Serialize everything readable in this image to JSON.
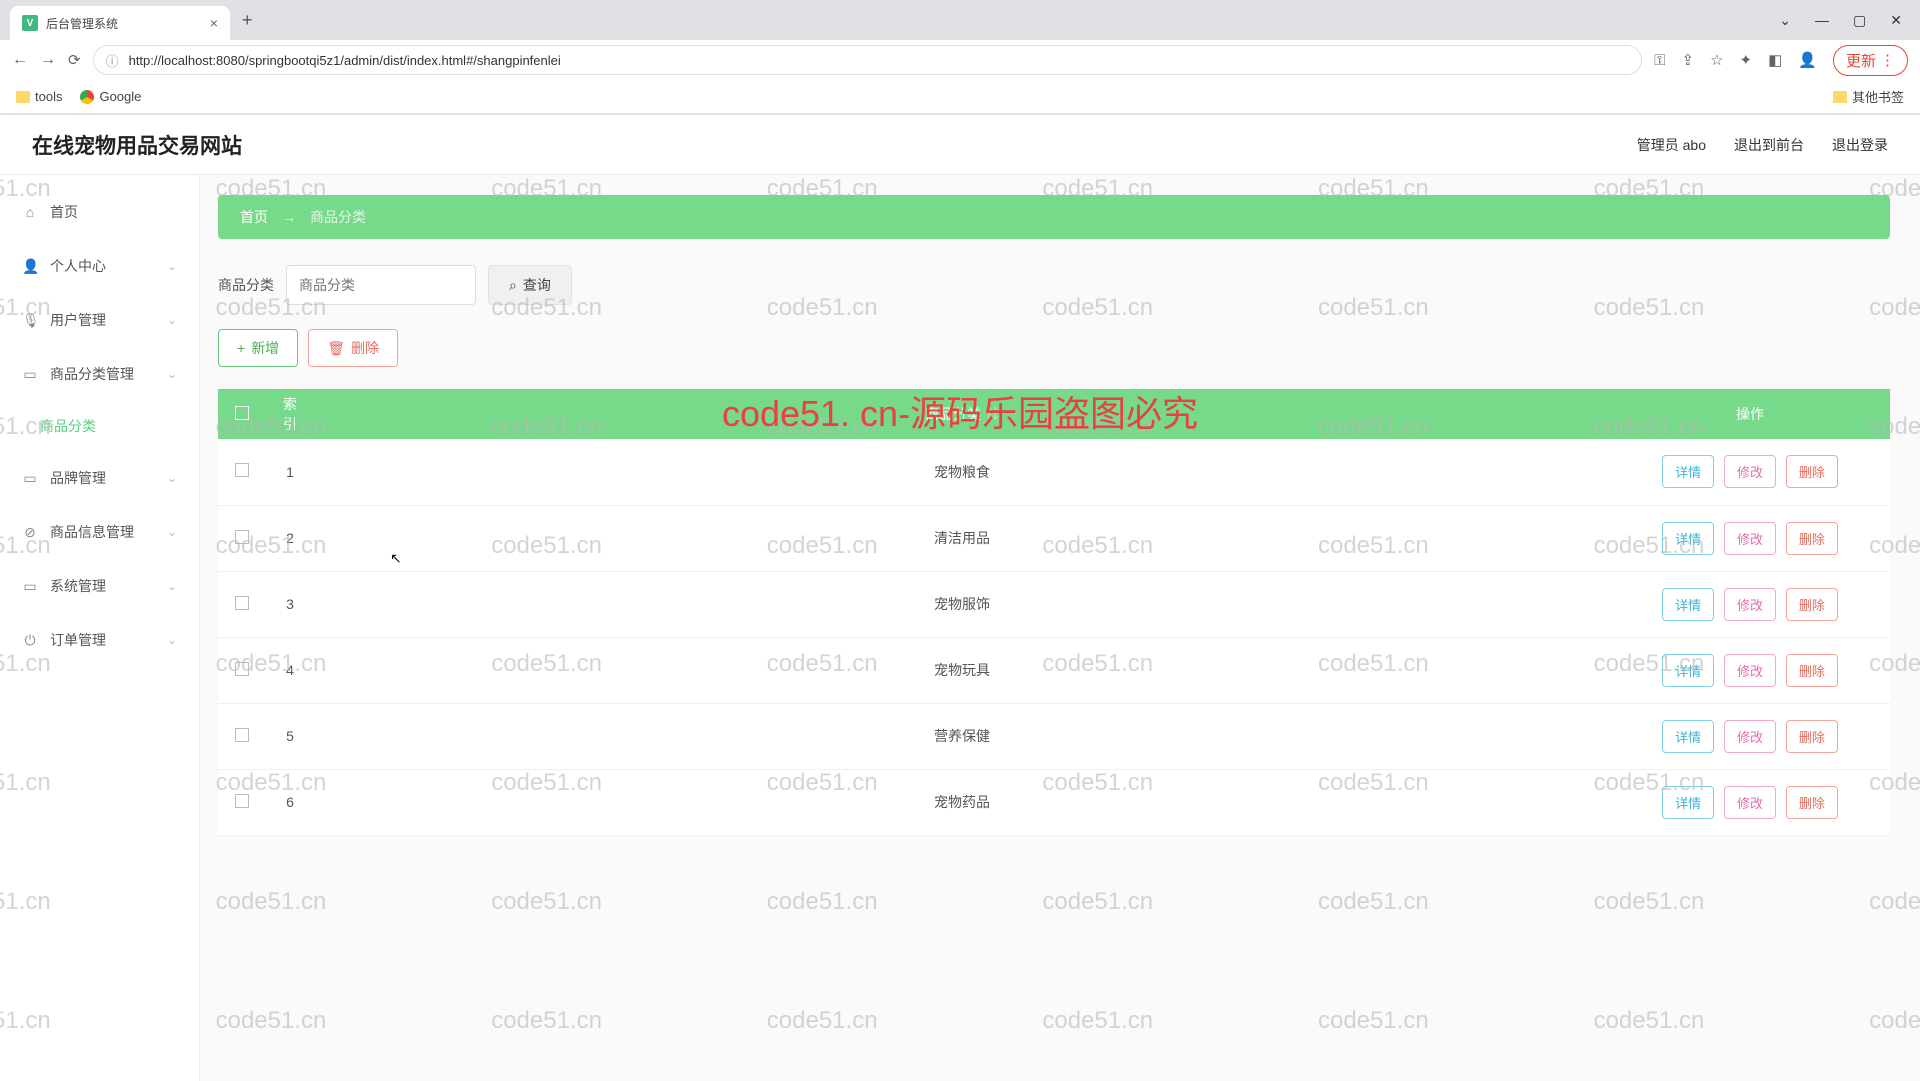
{
  "browser": {
    "tab_title": "后台管理系统",
    "url": "http://localhost:8080/springbootqi5z1/admin/dist/index.html#/shangpinfenlei",
    "bookmarks": {
      "tools": "tools",
      "google": "Google",
      "other": "其他书签"
    },
    "update": "更新"
  },
  "header": {
    "title": "在线宠物用品交易网站",
    "admin": "管理员 abo",
    "logout_front": "退出到前台",
    "logout": "退出登录"
  },
  "sidebar": {
    "items": [
      {
        "icon": "⌂",
        "label": "首页",
        "expandable": false
      },
      {
        "icon": "👤",
        "label": "个人中心",
        "expandable": true
      },
      {
        "icon": "🎙",
        "label": "用户管理",
        "expandable": true
      },
      {
        "icon": "▭",
        "label": "商品分类管理",
        "expandable": true,
        "sub": "商品分类"
      },
      {
        "icon": "▭",
        "label": "品牌管理",
        "expandable": true
      },
      {
        "icon": "⊘",
        "label": "商品信息管理",
        "expandable": true
      },
      {
        "icon": "▭",
        "label": "系统管理",
        "expandable": true
      },
      {
        "icon": "⏻",
        "label": "订单管理",
        "expandable": true
      }
    ]
  },
  "breadcrumb": {
    "home": "首页",
    "current": "商品分类"
  },
  "search": {
    "label": "商品分类",
    "placeholder": "商品分类",
    "btn": "查询"
  },
  "actions": {
    "add": "新增",
    "del": "删除"
  },
  "table": {
    "headers": {
      "index": "索引",
      "category": "商品分类",
      "ops": "操作"
    },
    "op_labels": {
      "detail": "详情",
      "edit": "修改",
      "del": "删除"
    },
    "rows": [
      {
        "idx": "1",
        "name": "宠物粮食"
      },
      {
        "idx": "2",
        "name": "清洁用品"
      },
      {
        "idx": "3",
        "name": "宠物服饰"
      },
      {
        "idx": "4",
        "name": "宠物玩具"
      },
      {
        "idx": "5",
        "name": "营养保健"
      },
      {
        "idx": "6",
        "name": "宠物药品"
      }
    ]
  },
  "watermark": {
    "text": "code51.cn",
    "banner": "code51. cn-源码乐园盗图必究"
  }
}
